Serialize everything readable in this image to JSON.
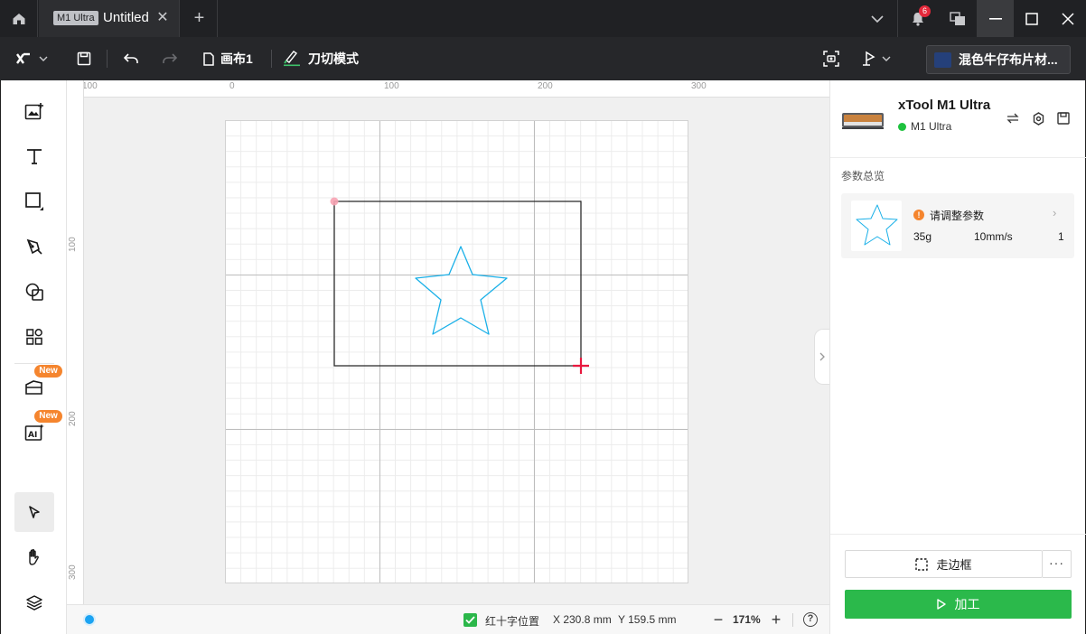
{
  "titlebar": {
    "tab_badge": "M1 Ultra",
    "tab_title": "Untitled",
    "notifications_count": "6"
  },
  "toolbar": {
    "canvas_name": "画布1",
    "mode_label": "刀切模式",
    "material_label": "混色牛仔布片材...",
    "material_color": "#25407a"
  },
  "sidebar": {
    "new_badge": "New",
    "tools": [
      "add-image",
      "text",
      "shape",
      "pen",
      "boolean",
      "elements",
      "projects",
      "ai",
      "select",
      "hand",
      "layers"
    ]
  },
  "canvas": {
    "ruler_top_labels": [
      "100",
      "0",
      "100",
      "200",
      "300"
    ],
    "ruler_left_labels": [
      "100",
      "200",
      "300"
    ],
    "selection_color": "#1f1f1f",
    "shape_stroke_color": "#1ab0e8",
    "crosshair_color": "#e8193f"
  },
  "statusbar": {
    "cross_label": "红十字位置",
    "x_coord": "X 230.8 mm",
    "y_coord": "Y 159.5 mm",
    "zoom": "171%",
    "zoom_out": "−",
    "zoom_in": "+",
    "help": "?"
  },
  "panel": {
    "device_name": "xTool M1 Ultra",
    "device_status": "M1 Ultra",
    "overview_label": "参数总览",
    "param_warning": "请调整参数",
    "param_power": "35g",
    "param_speed": "10mm/s",
    "param_passes": "1",
    "frame_label": "走边框",
    "more_label": "···",
    "process_label": "加工",
    "accent_color": "#2bb94b"
  }
}
